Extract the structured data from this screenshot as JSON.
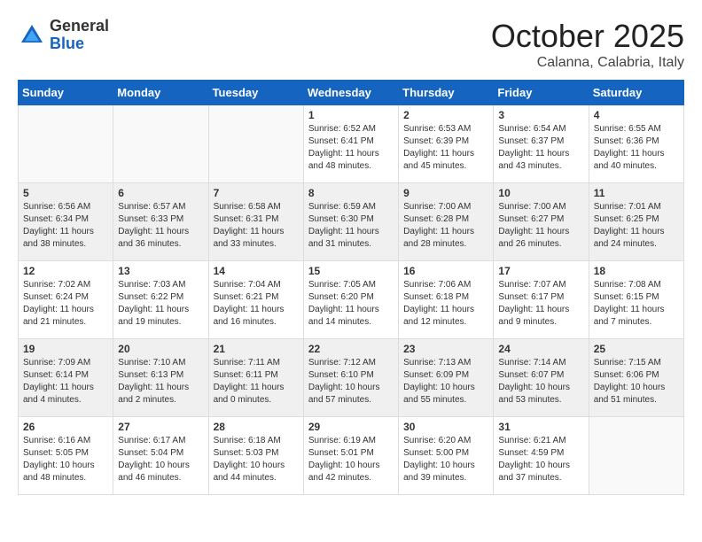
{
  "logo": {
    "general": "General",
    "blue": "Blue"
  },
  "header": {
    "month": "October 2025",
    "location": "Calanna, Calabria, Italy"
  },
  "days_of_week": [
    "Sunday",
    "Monday",
    "Tuesday",
    "Wednesday",
    "Thursday",
    "Friday",
    "Saturday"
  ],
  "weeks": [
    [
      {
        "day": "",
        "info": ""
      },
      {
        "day": "",
        "info": ""
      },
      {
        "day": "",
        "info": ""
      },
      {
        "day": "1",
        "info": "Sunrise: 6:52 AM\nSunset: 6:41 PM\nDaylight: 11 hours\nand 48 minutes."
      },
      {
        "day": "2",
        "info": "Sunrise: 6:53 AM\nSunset: 6:39 PM\nDaylight: 11 hours\nand 45 minutes."
      },
      {
        "day": "3",
        "info": "Sunrise: 6:54 AM\nSunset: 6:37 PM\nDaylight: 11 hours\nand 43 minutes."
      },
      {
        "day": "4",
        "info": "Sunrise: 6:55 AM\nSunset: 6:36 PM\nDaylight: 11 hours\nand 40 minutes."
      }
    ],
    [
      {
        "day": "5",
        "info": "Sunrise: 6:56 AM\nSunset: 6:34 PM\nDaylight: 11 hours\nand 38 minutes."
      },
      {
        "day": "6",
        "info": "Sunrise: 6:57 AM\nSunset: 6:33 PM\nDaylight: 11 hours\nand 36 minutes."
      },
      {
        "day": "7",
        "info": "Sunrise: 6:58 AM\nSunset: 6:31 PM\nDaylight: 11 hours\nand 33 minutes."
      },
      {
        "day": "8",
        "info": "Sunrise: 6:59 AM\nSunset: 6:30 PM\nDaylight: 11 hours\nand 31 minutes."
      },
      {
        "day": "9",
        "info": "Sunrise: 7:00 AM\nSunset: 6:28 PM\nDaylight: 11 hours\nand 28 minutes."
      },
      {
        "day": "10",
        "info": "Sunrise: 7:00 AM\nSunset: 6:27 PM\nDaylight: 11 hours\nand 26 minutes."
      },
      {
        "day": "11",
        "info": "Sunrise: 7:01 AM\nSunset: 6:25 PM\nDaylight: 11 hours\nand 24 minutes."
      }
    ],
    [
      {
        "day": "12",
        "info": "Sunrise: 7:02 AM\nSunset: 6:24 PM\nDaylight: 11 hours\nand 21 minutes."
      },
      {
        "day": "13",
        "info": "Sunrise: 7:03 AM\nSunset: 6:22 PM\nDaylight: 11 hours\nand 19 minutes."
      },
      {
        "day": "14",
        "info": "Sunrise: 7:04 AM\nSunset: 6:21 PM\nDaylight: 11 hours\nand 16 minutes."
      },
      {
        "day": "15",
        "info": "Sunrise: 7:05 AM\nSunset: 6:20 PM\nDaylight: 11 hours\nand 14 minutes."
      },
      {
        "day": "16",
        "info": "Sunrise: 7:06 AM\nSunset: 6:18 PM\nDaylight: 11 hours\nand 12 minutes."
      },
      {
        "day": "17",
        "info": "Sunrise: 7:07 AM\nSunset: 6:17 PM\nDaylight: 11 hours\nand 9 minutes."
      },
      {
        "day": "18",
        "info": "Sunrise: 7:08 AM\nSunset: 6:15 PM\nDaylight: 11 hours\nand 7 minutes."
      }
    ],
    [
      {
        "day": "19",
        "info": "Sunrise: 7:09 AM\nSunset: 6:14 PM\nDaylight: 11 hours\nand 4 minutes."
      },
      {
        "day": "20",
        "info": "Sunrise: 7:10 AM\nSunset: 6:13 PM\nDaylight: 11 hours\nand 2 minutes."
      },
      {
        "day": "21",
        "info": "Sunrise: 7:11 AM\nSunset: 6:11 PM\nDaylight: 11 hours\nand 0 minutes."
      },
      {
        "day": "22",
        "info": "Sunrise: 7:12 AM\nSunset: 6:10 PM\nDaylight: 10 hours\nand 57 minutes."
      },
      {
        "day": "23",
        "info": "Sunrise: 7:13 AM\nSunset: 6:09 PM\nDaylight: 10 hours\nand 55 minutes."
      },
      {
        "day": "24",
        "info": "Sunrise: 7:14 AM\nSunset: 6:07 PM\nDaylight: 10 hours\nand 53 minutes."
      },
      {
        "day": "25",
        "info": "Sunrise: 7:15 AM\nSunset: 6:06 PM\nDaylight: 10 hours\nand 51 minutes."
      }
    ],
    [
      {
        "day": "26",
        "info": "Sunrise: 6:16 AM\nSunset: 5:05 PM\nDaylight: 10 hours\nand 48 minutes."
      },
      {
        "day": "27",
        "info": "Sunrise: 6:17 AM\nSunset: 5:04 PM\nDaylight: 10 hours\nand 46 minutes."
      },
      {
        "day": "28",
        "info": "Sunrise: 6:18 AM\nSunset: 5:03 PM\nDaylight: 10 hours\nand 44 minutes."
      },
      {
        "day": "29",
        "info": "Sunrise: 6:19 AM\nSunset: 5:01 PM\nDaylight: 10 hours\nand 42 minutes."
      },
      {
        "day": "30",
        "info": "Sunrise: 6:20 AM\nSunset: 5:00 PM\nDaylight: 10 hours\nand 39 minutes."
      },
      {
        "day": "31",
        "info": "Sunrise: 6:21 AM\nSunset: 4:59 PM\nDaylight: 10 hours\nand 37 minutes."
      },
      {
        "day": "",
        "info": ""
      }
    ]
  ]
}
